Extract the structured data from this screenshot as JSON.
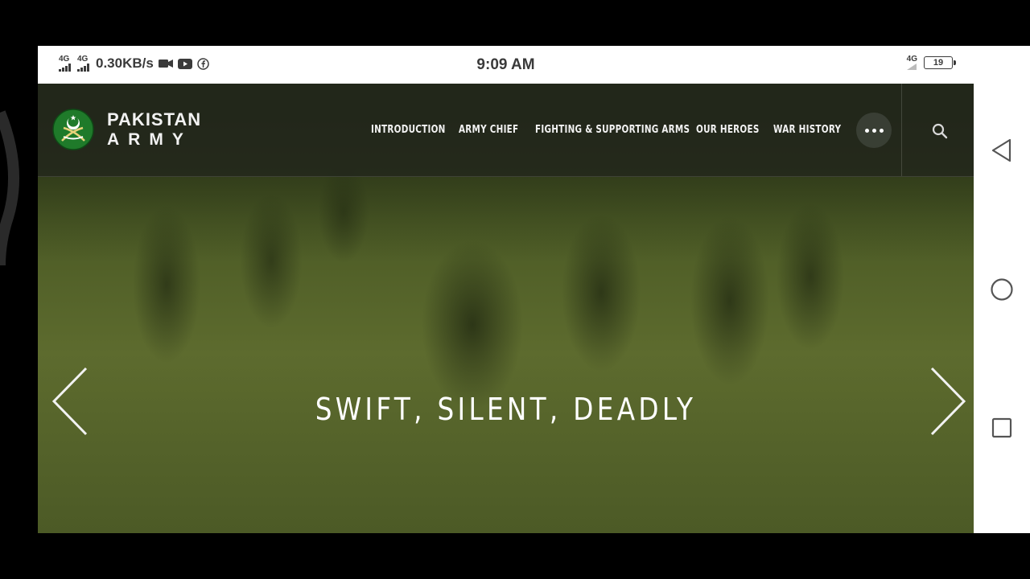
{
  "status_bar": {
    "network_1": "4G",
    "network_2": "4G",
    "speed": "0.30KB/s",
    "time": "9:09 AM",
    "network_right": "4G",
    "battery": "19"
  },
  "site": {
    "logo_line1": "PAKISTAN",
    "logo_line2": "ARMY",
    "nav": [
      "INTRODUCTION",
      "ARMY CHIEF",
      "FIGHTING & SUPPORTING ARMS",
      "OUR HEROES",
      "WAR HISTORY"
    ],
    "slogan": "SWIFT, SILENT, DEADLY"
  },
  "colors": {
    "overlay_green": "#5d6b2e",
    "emblem_green": "#1f7a2a",
    "nav_bg": "#22261c"
  },
  "icons": [
    "video-camera-icon",
    "youtube-icon",
    "facebook-icon",
    "more-icon",
    "search-icon",
    "chevron-left-icon",
    "chevron-right-icon",
    "back-icon",
    "home-icon",
    "recents-icon"
  ]
}
